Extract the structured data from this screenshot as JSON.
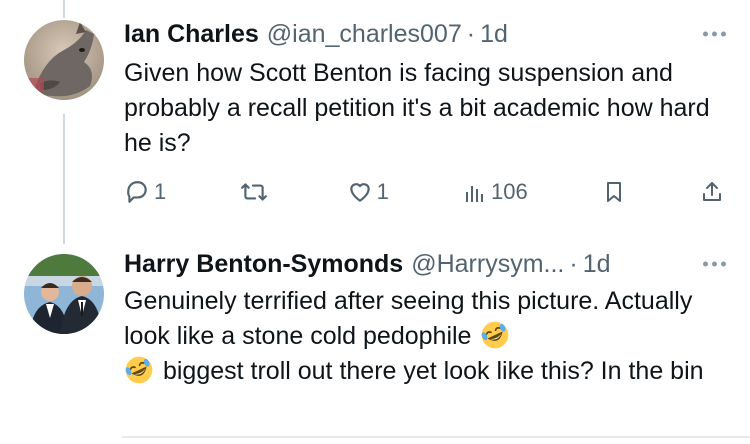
{
  "tweets": [
    {
      "name": "Ian Charles",
      "handle": "@ian_charles007",
      "separator": "·",
      "time": "1d",
      "text": "Given how Scott Benton is facing suspension and probably a recall petition it's a bit academic how hard he is?",
      "actions": {
        "replies": "1",
        "retweets": "",
        "likes": "1",
        "views": "106"
      }
    },
    {
      "name": "Harry Benton-Symonds",
      "handle": "@Harrysym...",
      "separator": "·",
      "time": "1d",
      "text_part1": "Genuinely terrified after seeing this picture. Actually look like a stone cold pedophile",
      "text_part2": "biggest troll out there yet look like this? In the bin"
    }
  ],
  "icons": {
    "reply": "reply-icon",
    "retweet": "retweet-icon",
    "like": "heart-icon",
    "views": "views-chart-icon",
    "bookmark": "bookmark-icon",
    "share": "share-icon",
    "more": "more-dots-icon",
    "emoji": "rolling-on-floor-laughing-emoji"
  },
  "colors": {
    "text": "#0f1419",
    "secondary": "#536471",
    "thread_line": "#cfd9de",
    "emoji_yellow": "#ffcc4d"
  }
}
